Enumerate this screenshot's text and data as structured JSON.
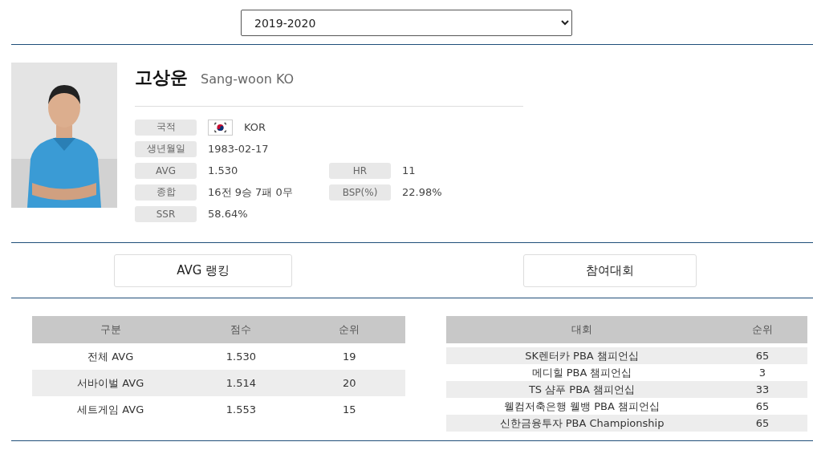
{
  "season_select": {
    "value": "2019-2020"
  },
  "player": {
    "name_ko": "고상운",
    "name_en": "Sang-woon KO",
    "info": [
      {
        "label": "국적",
        "value": "KOR",
        "flag": true
      },
      {
        "label": "생년월일",
        "value": "1983-02-17"
      },
      {
        "label": "AVG",
        "value": "1.530",
        "label2": "HR",
        "value2": "11"
      },
      {
        "label": "종합",
        "value": "16전 9승 7패 0무",
        "label2": "BSP(%)",
        "value2": "22.98%"
      },
      {
        "label": "SSR",
        "value": "58.64%"
      }
    ]
  },
  "tabs": [
    {
      "label": "AVG 랭킹"
    },
    {
      "label": "참여대회"
    }
  ],
  "ranking_table": {
    "columns": [
      "구분",
      "점수",
      "순위"
    ],
    "rows": [
      [
        "전체 AVG",
        "1.530",
        "19"
      ],
      [
        "서바이벌 AVG",
        "1.514",
        "20"
      ],
      [
        "세트게임 AVG",
        "1.553",
        "15"
      ]
    ]
  },
  "tournament_table": {
    "columns": [
      "대회",
      "순위"
    ],
    "rows": [
      [
        "SK렌터카 PBA 챔피언십",
        "65"
      ],
      [
        "메디힐 PBA 챔피언십",
        "3"
      ],
      [
        "TS 샴푸 PBA 챔피언십",
        "33"
      ],
      [
        "웰컴저축은행 웰뱅 PBA 챔피언십",
        "65"
      ],
      [
        "신한금융투자 PBA Championship",
        "65"
      ]
    ]
  }
}
